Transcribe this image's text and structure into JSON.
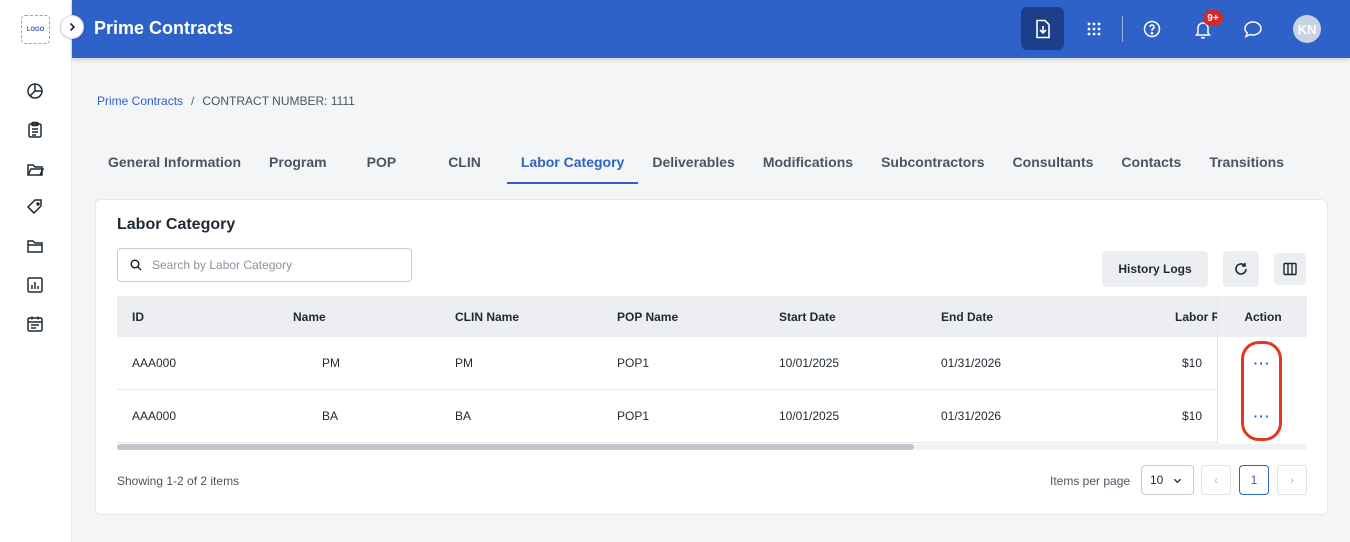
{
  "app": {
    "logo_text": "LOGO",
    "title": "Prime Contracts",
    "avatar_initials": "KN",
    "notification_count": "9+",
    "brand_color": "#2f62c8"
  },
  "sidebar": {
    "items": [
      {
        "icon": "pie-chart-icon"
      },
      {
        "icon": "clipboard-icon"
      },
      {
        "icon": "folder-open-icon"
      },
      {
        "icon": "tags-icon"
      },
      {
        "icon": "folder-icon"
      },
      {
        "icon": "bar-chart-icon"
      },
      {
        "icon": "calendar-icon"
      }
    ]
  },
  "header": {
    "icons": [
      "download-file-icon",
      "apps-grid-icon",
      "help-icon",
      "bell-icon",
      "chat-icon"
    ]
  },
  "breadcrumb": {
    "link": "Prime Contracts",
    "separator": "/",
    "current": "CONTRACT NUMBER: 1111"
  },
  "tabs": [
    "General Information",
    "Program",
    "POP",
    "CLIN",
    "Labor Category",
    "Deliverables",
    "Modifications",
    "Subcontractors",
    "Consultants",
    "Contacts",
    "Transitions"
  ],
  "active_tab": "Labor Category",
  "card": {
    "title": "Labor Category",
    "search_placeholder": "Search by Labor Category",
    "history_logs_label": "History Logs"
  },
  "table": {
    "columns": [
      "ID",
      "Name",
      "CLIN Name",
      "POP Name",
      "Start Date",
      "End Date",
      "Labor Ra",
      "Action"
    ],
    "rows": [
      {
        "id": "AAA000",
        "name": "PM",
        "clin_name": "PM",
        "pop_name": "POP1",
        "start_date": "10/01/2025",
        "end_date": "01/31/2026",
        "labor_rate": "$10",
        "action": "···"
      },
      {
        "id": "AAA000",
        "name": "BA",
        "clin_name": "BA",
        "pop_name": "POP1",
        "start_date": "10/01/2025",
        "end_date": "01/31/2026",
        "labor_rate": "$10",
        "action": "···"
      }
    ]
  },
  "footer": {
    "showing": "Showing 1-2 of 2 items",
    "items_per_page_label": "Items per page",
    "items_per_page_value": "10",
    "current_page": "1",
    "prev": "‹",
    "next": "›"
  }
}
